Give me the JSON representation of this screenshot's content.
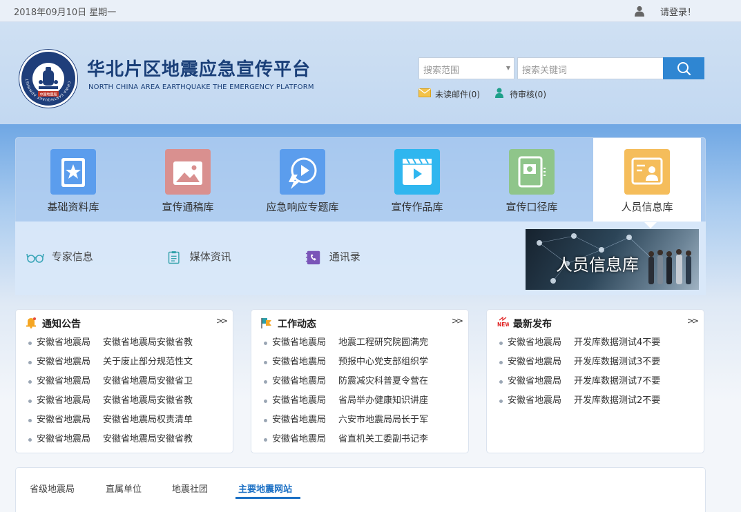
{
  "topbar": {
    "date": "2018年09月10日 星期一",
    "login": "请登录！",
    "user_icon": "user-icon"
  },
  "header": {
    "title": "华北片区地震应急宣传平台",
    "subtitle": "NORTH CHINA AREA EARTHQUAKE  THE EMERGENCY PLATFORM",
    "logo_ring_text": "CHINA EARTHQUAKE ADMINISTRATION",
    "logo_bottom_text": "中国地震局",
    "search": {
      "scope_placeholder": "搜索范围",
      "keyword_placeholder": "搜索关键词"
    },
    "unread_mail": "未读邮件(0)",
    "pending_audit": "待审核(0)"
  },
  "categories": [
    {
      "label": "基础资料库",
      "color": "#5b9ded",
      "icon": "book-star-icon"
    },
    {
      "label": "宣传通稿库",
      "color": "#d9908f",
      "icon": "wallet-image-icon"
    },
    {
      "label": "应急响应专题库",
      "color": "#5b9ded",
      "icon": "flash-play-icon"
    },
    {
      "label": "宣传作品库",
      "color": "#2fb6ef",
      "icon": "video-play-icon"
    },
    {
      "label": "宣传口径库",
      "color": "#8fc58a",
      "icon": "id-panel-icon"
    },
    {
      "label": "人员信息库",
      "color": "#f5bd5b",
      "icon": "person-card-icon"
    }
  ],
  "sub_items": [
    {
      "label": "专家信息",
      "icon": "glasses-icon"
    },
    {
      "label": "媒体资讯",
      "icon": "clipboard-icon"
    },
    {
      "label": "通讯录",
      "icon": "phone-book-icon"
    }
  ],
  "banner": {
    "text": "人员信息库"
  },
  "cards": [
    {
      "title": "通知公告",
      "icon": "bell-icon",
      "more": ">>",
      "items": [
        {
          "source": "安徽省地震局",
          "text": "安徽省地震局安徽省教"
        },
        {
          "source": "安徽省地震局",
          "text": "关于废止部分规范性文"
        },
        {
          "source": "安徽省地震局",
          "text": "安徽省地震局安徽省卫"
        },
        {
          "source": "安徽省地震局",
          "text": "安徽省地震局安徽省教"
        },
        {
          "source": "安徽省地震局",
          "text": "安徽省地震局权责清单"
        },
        {
          "source": "安徽省地震局",
          "text": "安徽省地震局安徽省教"
        }
      ]
    },
    {
      "title": "工作动态",
      "icon": "flag-icon",
      "more": ">>",
      "items": [
        {
          "source": "安徽省地震局",
          "text": "地震工程研究院圆满完"
        },
        {
          "source": "安徽省地震局",
          "text": "预报中心党支部组织学"
        },
        {
          "source": "安徽省地震局",
          "text": "防震减灾科普夏令营在"
        },
        {
          "source": "安徽省地震局",
          "text": "省局举办健康知识讲座"
        },
        {
          "source": "安徽省地震局",
          "text": "六安市地震局局长于军"
        },
        {
          "source": "安徽省地震局",
          "text": "省直机关工委副书记李"
        }
      ]
    },
    {
      "title": "最新发布",
      "icon": "new-badge-icon",
      "badge_text": "NEW",
      "more": ">>",
      "items": [
        {
          "source": "安徽省地震局",
          "text": "开发库数据测试4不要"
        },
        {
          "source": "安徽省地震局",
          "text": "开发库数据测试3不要"
        },
        {
          "source": "安徽省地震局",
          "text": "开发库数据测试7不要"
        },
        {
          "source": "安徽省地震局",
          "text": "开发库数据测试2不要"
        }
      ]
    }
  ],
  "link_tabs": {
    "items": [
      "省级地震局",
      "直属单位",
      "地震社团",
      "主要地震网站"
    ],
    "active": "主要地震网站"
  },
  "colors": {
    "brand": "#1a3f78",
    "accent": "#2f86d2",
    "active_tab": "#1a6fc4"
  }
}
